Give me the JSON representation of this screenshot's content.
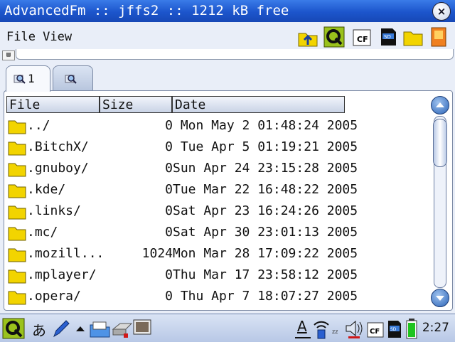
{
  "window": {
    "title": "AdvancedFm :: jffs2 :: 1212 kB free",
    "close_label": "×"
  },
  "menu": {
    "title": "File View"
  },
  "toolbar": {
    "icons": [
      "up-folder-icon",
      "qtopia-icon",
      "cf-card-icon",
      "sd-card-icon",
      "folder-icon",
      "document-icon"
    ]
  },
  "tabs": [
    {
      "label": "1",
      "icon": "magnifier-icon"
    },
    {
      "label": "",
      "icon": "magnifier-icon"
    }
  ],
  "columns": {
    "file": "File",
    "size": "Size",
    "date": "Date"
  },
  "files": [
    {
      "name": "../",
      "size": "0",
      "date": " Mon May 2 01:48:24 2005"
    },
    {
      "name": ".BitchX/",
      "size": "0",
      "date": " Tue Apr 5 01:19:21 2005"
    },
    {
      "name": ".gnuboy/",
      "size": "0",
      "date": "Sun Apr 24 23:15:28 2005"
    },
    {
      "name": ".kde/",
      "size": "0",
      "date": "Tue Mar 22 16:48:22 2005"
    },
    {
      "name": ".links/",
      "size": "0",
      "date": "Sat Apr 23 16:24:26 2005"
    },
    {
      "name": ".mc/",
      "size": "0",
      "date": "Sat Apr 30 23:01:13 2005"
    },
    {
      "name": ".mozill...",
      "size": "1024",
      "date": "Mon Mar 28 17:09:22 2005"
    },
    {
      "name": ".mplayer/",
      "size": "0",
      "date": "Thu Mar 17 23:58:12 2005"
    },
    {
      "name": ".opera/",
      "size": "0",
      "date": " Thu Apr 7 18:07:27 2005"
    }
  ],
  "taskbar": {
    "input_method": "あ",
    "keyboard_letter": "A",
    "time": "2:27"
  },
  "colors": {
    "titlebar": "#1c55cc",
    "folder": "#f2d400",
    "accent": "#2b64b8"
  }
}
